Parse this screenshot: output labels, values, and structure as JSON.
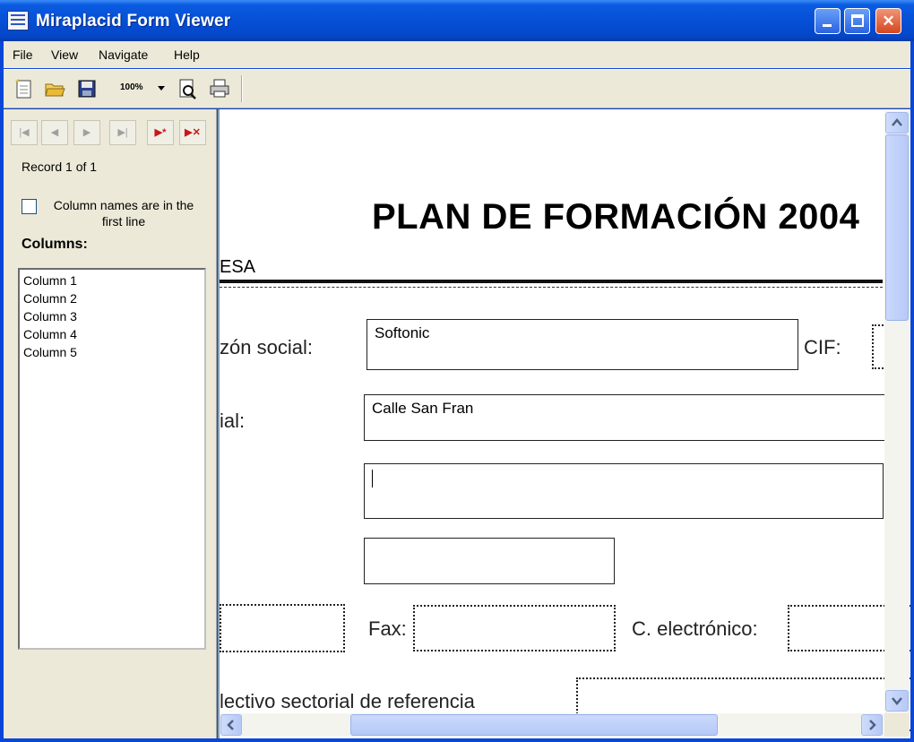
{
  "window": {
    "title": "Miraplacid Form Viewer"
  },
  "menu": {
    "file": "File",
    "view": "View",
    "navigate": "Navigate",
    "help": "Help"
  },
  "toolbar": {
    "zoom_value": "100%",
    "icons": [
      "new-icon",
      "open-folder-icon",
      "save-icon",
      "zoom-combo",
      "print-preview-icon",
      "print-icon"
    ]
  },
  "navigator": {
    "record_text": "Record 1 of 1",
    "checkbox_label": "Column names are in the first line",
    "checkbox_checked": false,
    "columns_label": "Columns:",
    "columns": [
      "Column 1",
      "Column 2",
      "Column 3",
      "Column 4",
      "Column 5"
    ]
  },
  "document": {
    "title": "PLAN DE FORMACIÓN 2004",
    "section_label": "ESA",
    "labels": {
      "razon_social": "zón social:",
      "cif": "CIF:",
      "domicilio": "ial:",
      "fax": "Fax:",
      "email": "C. electrónico:",
      "colectivo": "lectivo sectorial de referencia"
    },
    "fields": {
      "razon_social_value": "Softonic",
      "domicilio_value": "Calle San Fran"
    }
  },
  "colors": {
    "titlebar": "#0550d6",
    "chrome": "#ece9d8",
    "accent_red": "#c81818"
  }
}
